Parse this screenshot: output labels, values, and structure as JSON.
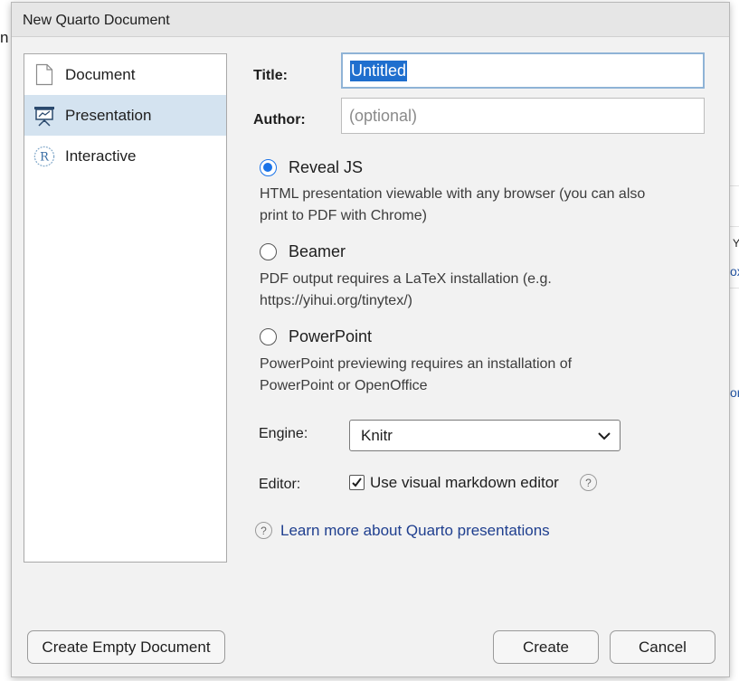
{
  "background": {
    "fragment_n": "n",
    "fragment_ox": "ox",
    "fragment_or": "or",
    "fragment_y": "Y"
  },
  "dialog": {
    "title": "New Quarto Document"
  },
  "doc_types": [
    {
      "label": "Document",
      "icon": "document-icon",
      "selected": false
    },
    {
      "label": "Presentation",
      "icon": "presentation-icon",
      "selected": true
    },
    {
      "label": "Interactive",
      "icon": "r-logo-icon",
      "selected": false
    }
  ],
  "fields": {
    "title_label": "Title:",
    "title_value": "Untitled",
    "author_label": "Author:",
    "author_placeholder": "(optional)"
  },
  "formats": [
    {
      "label": "Reveal JS",
      "checked": true,
      "desc_line1": "HTML presentation viewable with any browser (you can also",
      "desc_line2": "print to PDF with Chrome)"
    },
    {
      "label": "Beamer",
      "checked": false,
      "desc_line1": "PDF output requires a LaTeX installation (e.g.",
      "desc_line2": "https://yihui.org/tinytex/)"
    },
    {
      "label": "PowerPoint",
      "checked": false,
      "desc_line1": "PowerPoint previewing requires an installation of",
      "desc_line2": "PowerPoint or OpenOffice"
    }
  ],
  "engine": {
    "label": "Engine:",
    "value": "Knitr"
  },
  "editor": {
    "label": "Editor:",
    "checkbox_label": "Use visual markdown editor",
    "checked": true
  },
  "learn_more": "Learn more about Quarto presentations",
  "buttons": {
    "create_empty": "Create Empty Document",
    "create": "Create",
    "cancel": "Cancel"
  },
  "colors": {
    "accent": "#1a73e8",
    "selected_row": "#d4e3f0",
    "link": "#1f3f8f"
  }
}
